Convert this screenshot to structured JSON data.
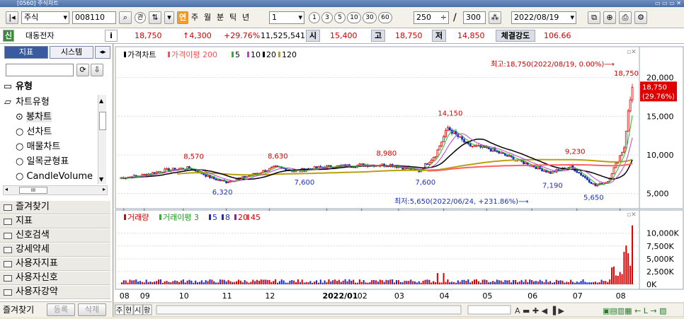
{
  "window": {
    "title": "[0560] 주식차트"
  },
  "toolbar": {
    "market": "주식",
    "code": "008110",
    "rel_label": "관",
    "link_label": "연",
    "periods": [
      "주",
      "월",
      "분",
      "틱",
      "년"
    ],
    "interval_value": "1",
    "minute_buttons": [
      "1",
      "3",
      "5",
      "10",
      "30",
      "60"
    ],
    "count_value": "250",
    "page_value": "300",
    "date_value": "2022/08/19"
  },
  "quote": {
    "name_tag": "신",
    "name": "대동전자",
    "info_label": "i",
    "price": "18,750",
    "change": "↑4,300",
    "change_rate": "+29.76%",
    "volume": "11,525,541",
    "open_label": "시",
    "open": "15,400",
    "high_label": "고",
    "high": "18,750",
    "low_label": "저",
    "low": "14,850",
    "strength_label": "체결강도",
    "strength": "106.66"
  },
  "left_panel": {
    "tabs": [
      "지표",
      "시스템"
    ],
    "search_placeholder": "",
    "type_header": "유형",
    "tree_parent": "차트유형",
    "chart_types": [
      "봉차트",
      "선차트",
      "매물차트",
      "일목균형표",
      "CandleVolume"
    ],
    "sections": [
      "즐겨찾기",
      "지표",
      "신호검색",
      "강세약세",
      "사용자지표",
      "사용자신호",
      "사용자강약"
    ],
    "bottom_label": "즐겨찾기",
    "bottom_buttons": [
      "등록",
      "삭제"
    ]
  },
  "chart_data": [
    {
      "type": "line",
      "panel": "price",
      "legend": [
        "가격차트",
        "가격이평 200",
        "5",
        "10",
        "20",
        "120"
      ],
      "colors": {
        "price_up": "#e00000",
        "price_down": "#1a2ec0",
        "ma5": "#22bb22",
        "ma10": "#c040d0",
        "ma20": "#000000",
        "ma120": "#b8a010",
        "ma200": "#ff6060"
      },
      "y_ticks": [
        20000,
        15000,
        10000,
        5000
      ],
      "y_tick_labels": [
        "20,000",
        "15,000",
        "10,000",
        "5,000"
      ],
      "ylim": [
        3500,
        21800
      ],
      "x_range": [
        0,
        250
      ],
      "last_price_label": "18,750",
      "last_change_label": "(29.76%)",
      "annotations": [
        {
          "text": "8,570",
          "x": 36,
          "y": 8570,
          "color": "#d00000"
        },
        {
          "text": "8,630",
          "x": 77,
          "y": 8630,
          "color": "#d00000"
        },
        {
          "text": "8,980",
          "x": 130,
          "y": 8980,
          "color": "#d00000"
        },
        {
          "text": "14,150",
          "x": 160,
          "y": 14150,
          "color": "#d00000"
        },
        {
          "text": "9,230",
          "x": 222,
          "y": 9230,
          "color": "#d00000"
        },
        {
          "text": "6,320",
          "x": 50,
          "y": 6320,
          "color": "#1a2ec0"
        },
        {
          "text": "7,600",
          "x": 90,
          "y": 7600,
          "color": "#1a2ec0"
        },
        {
          "text": "7,600",
          "x": 149,
          "y": 7600,
          "color": "#1a2ec0"
        },
        {
          "text": "7,190",
          "x": 211,
          "y": 7190,
          "color": "#1a2ec0"
        },
        {
          "text": "5,650",
          "x": 231,
          "y": 5650,
          "color": "#1a2ec0"
        }
      ],
      "high_note": "최고:18,750(2022/08/19, 0.00%)⟶",
      "low_note": "최저:5,650(2022/06/24, +231.86%)⟶",
      "high_value_label": "18,750",
      "key_points": [
        [
          0,
          7000
        ],
        [
          10,
          7300
        ],
        [
          22,
          8000
        ],
        [
          34,
          8300
        ],
        [
          46,
          6900
        ],
        [
          52,
          6500
        ],
        [
          62,
          7200
        ],
        [
          76,
          8400
        ],
        [
          86,
          7900
        ],
        [
          98,
          8400
        ],
        [
          118,
          8700
        ],
        [
          132,
          8700
        ],
        [
          146,
          7900
        ],
        [
          154,
          10000
        ],
        [
          160,
          13500
        ],
        [
          170,
          11200
        ],
        [
          180,
          10800
        ],
        [
          195,
          9200
        ],
        [
          210,
          7700
        ],
        [
          220,
          8500
        ],
        [
          232,
          6000
        ],
        [
          238,
          6600
        ],
        [
          246,
          11000
        ],
        [
          248,
          15500
        ],
        [
          250,
          18750
        ]
      ]
    },
    {
      "type": "bar",
      "panel": "volume",
      "legend": [
        "거래량",
        "거래이평 3",
        "5",
        "8",
        "20",
        "45"
      ],
      "y_ticks": [
        10000,
        7500,
        5000,
        2500,
        0
      ],
      "y_tick_labels": [
        "10,000K",
        "7,500K",
        "5,000K",
        "2,500K",
        "0K"
      ],
      "ylim": [
        0,
        13000
      ],
      "max_label": "11,525K"
    }
  ],
  "x_axis": {
    "labels": [
      {
        "x": 2,
        "text": "08",
        "bold": false
      },
      {
        "x": 12,
        "text": "09",
        "bold": false
      },
      {
        "x": 31,
        "text": "10",
        "bold": false
      },
      {
        "x": 52,
        "text": "11",
        "bold": false
      },
      {
        "x": 73,
        "text": "12",
        "bold": false
      },
      {
        "x": 101,
        "text": "2022/01",
        "bold": true
      },
      {
        "x": 118,
        "text": "02",
        "bold": false
      },
      {
        "x": 136,
        "text": "03",
        "bold": false
      },
      {
        "x": 158,
        "text": "04",
        "bold": false
      },
      {
        "x": 179,
        "text": "05",
        "bold": false
      },
      {
        "x": 201,
        "text": "06",
        "bold": false
      },
      {
        "x": 223,
        "text": "07",
        "bold": false
      },
      {
        "x": 244,
        "text": "08",
        "bold": false
      }
    ]
  },
  "bottom_bar": {
    "left_buttons": [
      "주",
      "현",
      "시",
      "황"
    ]
  }
}
